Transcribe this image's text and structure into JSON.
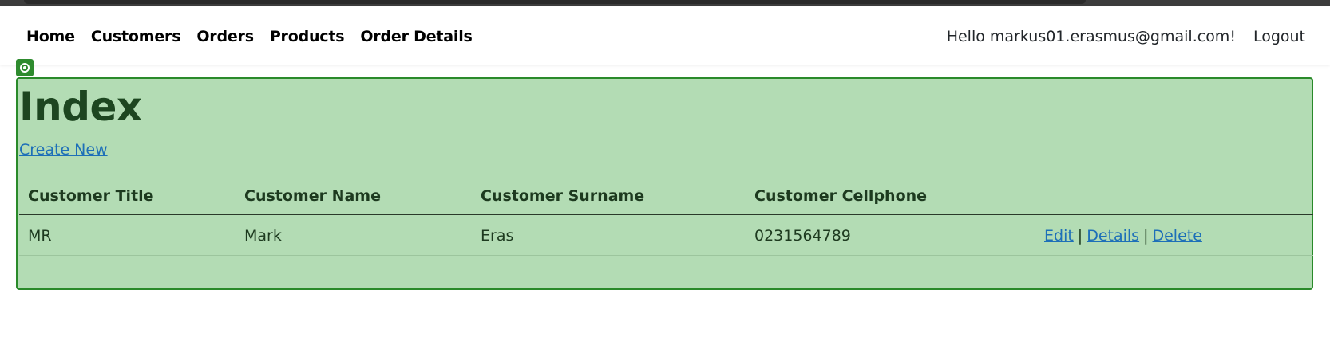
{
  "nav": {
    "links": [
      "Home",
      "Customers",
      "Orders",
      "Products",
      "Order Details"
    ],
    "hello": "Hello markus01.erasmus@gmail.com!",
    "logout": "Logout"
  },
  "page": {
    "title": "Index",
    "create_new": "Create New"
  },
  "table": {
    "headers": [
      "Customer Title",
      "Customer Name",
      "Customer Surname",
      "Customer Cellphone"
    ],
    "rows": [
      {
        "title": "MR",
        "name": "Mark",
        "surname": "Eras",
        "cellphone": "0231564789",
        "actions": {
          "edit": "Edit",
          "sep": "|",
          "details": "Details",
          "delete": "Delete"
        }
      }
    ]
  },
  "colors": {
    "highlight_fill": "#b3dcb4",
    "highlight_border": "#2a8a2a",
    "link": "#1d6fb8"
  },
  "icons": {
    "highlight_badge": "target-icon"
  }
}
